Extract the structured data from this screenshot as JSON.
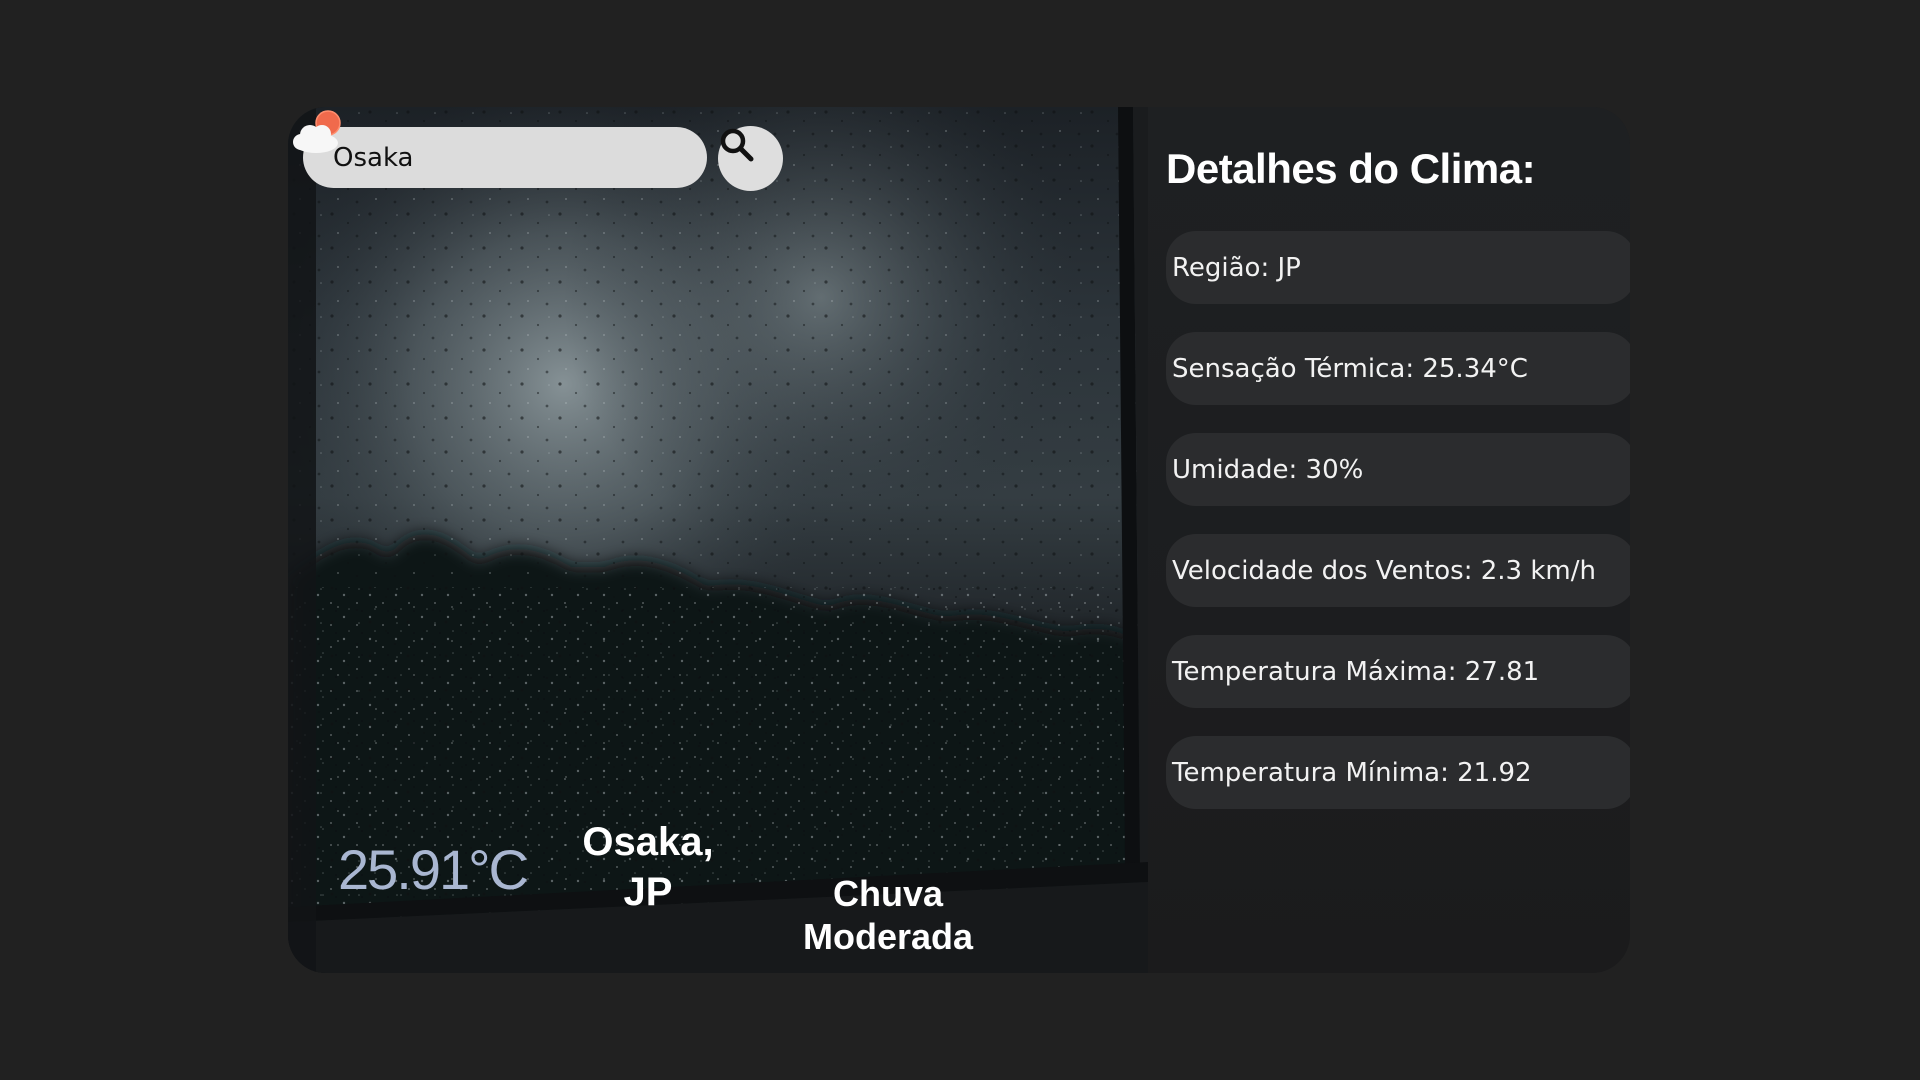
{
  "search": {
    "value": "Osaka",
    "button_icon": "search-icon"
  },
  "current": {
    "temperature": "25.91°C",
    "city": "Osaka,",
    "country": "JP",
    "condition_line1": "Chuva",
    "condition_line2": "Moderada",
    "condition_icon": "cloud-with-sun-icon"
  },
  "details": {
    "title": "Detalhes do Clima:",
    "items": [
      {
        "label": "Região: JP"
      },
      {
        "label": "Sensação Térmica: 25.34°C"
      },
      {
        "label": "Umidade: 30%"
      },
      {
        "label": "Velocidade dos Ventos: 2.3 km/h"
      },
      {
        "label": "Temperatura Máxima: 27.81"
      },
      {
        "label": "Temperatura Mínima: 21.92"
      }
    ]
  },
  "colors": {
    "page_background": "#212121",
    "temperature_text": "#a9b6d1",
    "detail_item_background": "#2b2c2e",
    "search_field": "#dcdcdc"
  }
}
